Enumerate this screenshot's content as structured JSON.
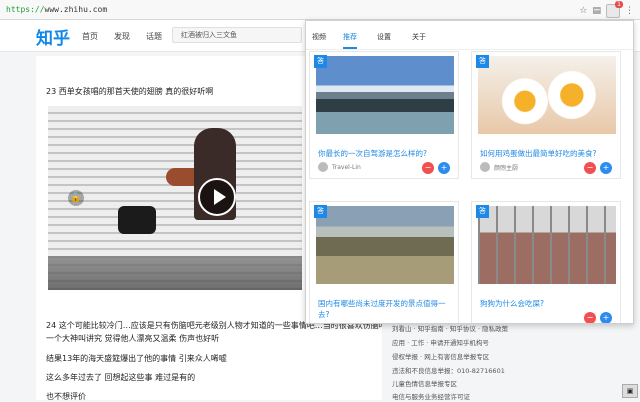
{
  "browser": {
    "url_prefix": "https://",
    "url_rest": "www.zhihu.com",
    "extension_badge": "1"
  },
  "site": {
    "logo": "知乎",
    "nav": [
      "首页",
      "发现",
      "话题"
    ],
    "search_placeholder": "红酒被归入三文鱼"
  },
  "main": {
    "q23": "23 西单女孩唱的那首天使的翅膀 真的很好听啊",
    "line1": "24 这个可能比较冷门…应该是只有伤脑吧元老级别人物才知道的一些事情吧…当时很喜欢伤脑吧的",
    "line2": "一个大神叫讲究 觉得他人漂亮又温柔 伤声也好听",
    "line3": "结果13年的海天盛筵爆出了他的事情 引来众人唏嘘",
    "line4": "这么多年过去了 回想起这些事 难过是有的",
    "line5": "也不想评价"
  },
  "popup": {
    "tabs": [
      "视频",
      "推荐",
      "设置",
      "关于"
    ],
    "active_tab": "推荐",
    "cards": [
      {
        "tag": "答",
        "title": "你最长的一次自驾游是怎么样的?",
        "author": "Travel-Lin",
        "image": "mountain"
      },
      {
        "tag": "答",
        "title": "如何用鸡蛋做出最简单好吃的美食?",
        "author": "颜煦主厨",
        "image": "egg"
      },
      {
        "tag": "答",
        "title": "国内有哪些尚未过度开发的景点值得一去?",
        "author": "",
        "image": "desert"
      },
      {
        "tag": "答",
        "title": "狗狗为什么会吃屎?",
        "author": "",
        "image": "cabin"
      }
    ]
  },
  "sidebar": {
    "links": [
      "刘看山 · 知乎指南 · 知乎协议 · 隐私政策",
      "应用 · 工作 · 申请开通知乎机构号",
      "侵权举报 · 网上有害信息举报专区",
      "违法和不良信息举报：010-82716601",
      "儿童色情信息举报专区",
      "电信与服务业务经营许可证"
    ]
  },
  "icons": {
    "star": "star-icon",
    "lock": "lock-icon",
    "play": "play-icon"
  },
  "colors": {
    "brand": "#0f88eb",
    "active": "#1e88e5",
    "dislike": "#f25050",
    "like": "#2d8cf0"
  }
}
